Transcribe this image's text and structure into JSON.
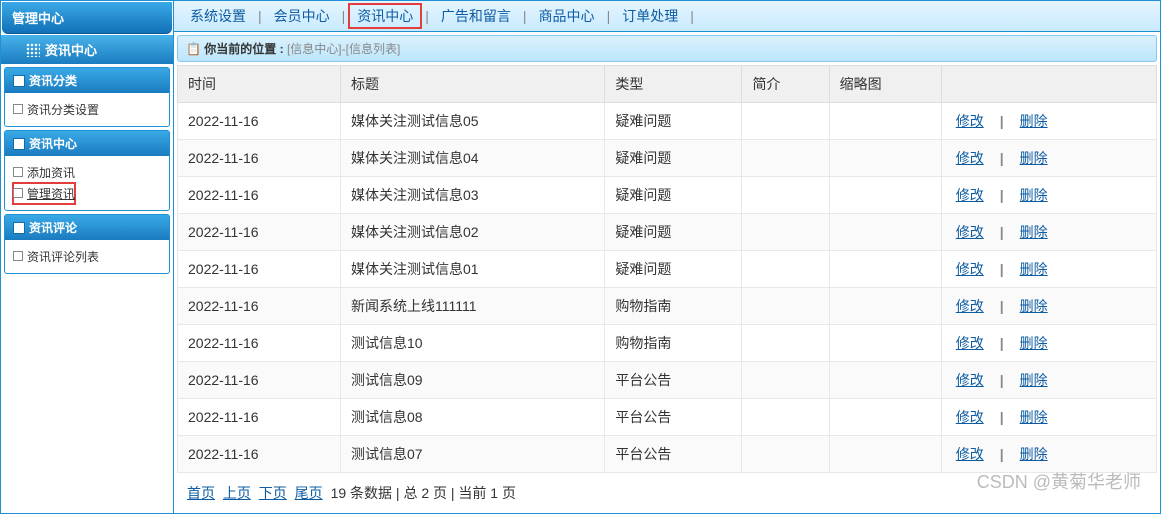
{
  "sidebar": {
    "header": "管理中心",
    "title": "资讯中心",
    "panels": [
      {
        "header": "资讯分类",
        "items": [
          {
            "label": "资讯分类设置",
            "highlighted": false
          }
        ]
      },
      {
        "header": "资讯中心",
        "items": [
          {
            "label": "添加资讯",
            "highlighted": false
          },
          {
            "label": "管理资讯",
            "highlighted": true
          }
        ]
      },
      {
        "header": "资讯评论",
        "items": [
          {
            "label": "资讯评论列表",
            "highlighted": false
          }
        ]
      }
    ]
  },
  "topnav": {
    "items": [
      {
        "label": "系统设置",
        "highlighted": false
      },
      {
        "label": "会员中心",
        "highlighted": false
      },
      {
        "label": "资讯中心",
        "highlighted": true
      },
      {
        "label": "广告和留言",
        "highlighted": false
      },
      {
        "label": "商品中心",
        "highlighted": false
      },
      {
        "label": "订单处理",
        "highlighted": false
      }
    ]
  },
  "breadcrumb": {
    "prefix": "你当前的位置 : ",
    "path": "[信息中心]-[信息列表]"
  },
  "table": {
    "headers": [
      "时间",
      "标题",
      "类型",
      "简介",
      "缩略图",
      ""
    ],
    "action_edit": "修改",
    "action_delete": "删除",
    "rows": [
      {
        "time": "2022-11-16",
        "title": "媒体关注测试信息05",
        "type": "疑难问题",
        "intro": "",
        "thumb": ""
      },
      {
        "time": "2022-11-16",
        "title": "媒体关注测试信息04",
        "type": "疑难问题",
        "intro": "",
        "thumb": ""
      },
      {
        "time": "2022-11-16",
        "title": "媒体关注测试信息03",
        "type": "疑难问题",
        "intro": "",
        "thumb": ""
      },
      {
        "time": "2022-11-16",
        "title": "媒体关注测试信息02",
        "type": "疑难问题",
        "intro": "",
        "thumb": ""
      },
      {
        "time": "2022-11-16",
        "title": "媒体关注测试信息01",
        "type": "疑难问题",
        "intro": "",
        "thumb": ""
      },
      {
        "time": "2022-11-16",
        "title": "新闻系统上线111111",
        "type": "购物指南",
        "intro": "",
        "thumb": ""
      },
      {
        "time": "2022-11-16",
        "title": "测试信息10",
        "type": "购物指南",
        "intro": "",
        "thumb": ""
      },
      {
        "time": "2022-11-16",
        "title": "测试信息09",
        "type": "平台公告",
        "intro": "",
        "thumb": ""
      },
      {
        "time": "2022-11-16",
        "title": "测试信息08",
        "type": "平台公告",
        "intro": "",
        "thumb": ""
      },
      {
        "time": "2022-11-16",
        "title": "测试信息07",
        "type": "平台公告",
        "intro": "",
        "thumb": ""
      }
    ]
  },
  "pagination": {
    "first": "首页",
    "prev": "上页",
    "next": "下页",
    "last": "尾页",
    "summary": "19 条数据 | 总 2 页 | 当前 1 页"
  },
  "watermark": "CSDN @黄菊华老师"
}
